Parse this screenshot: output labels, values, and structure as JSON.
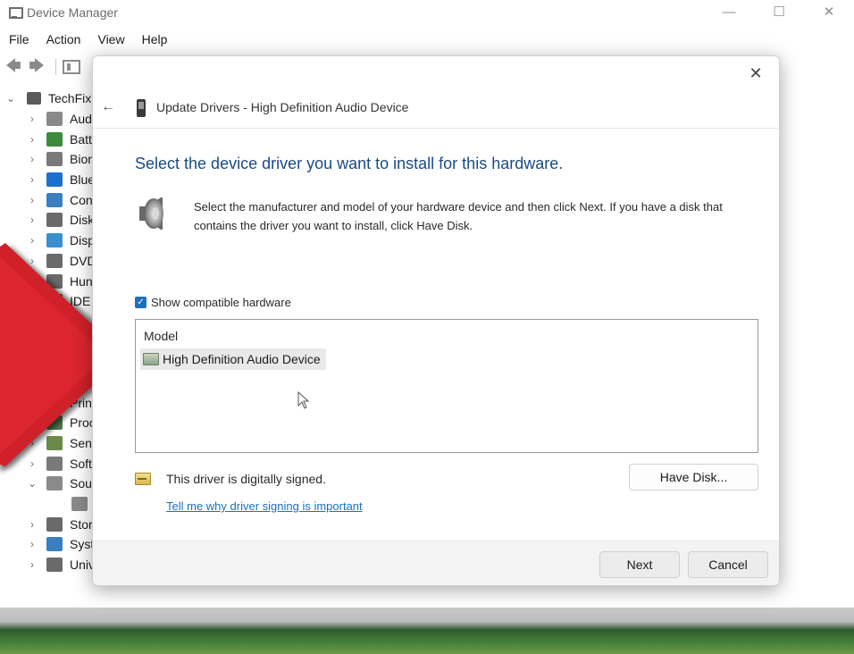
{
  "window": {
    "title": "Device Manager",
    "controls": {
      "minimize": "—",
      "maximize": "☐",
      "close": "✕"
    }
  },
  "menubar": {
    "items": [
      "File",
      "Action",
      "View",
      "Help"
    ]
  },
  "tree": {
    "root": "TechFix",
    "items": [
      {
        "label": "Aud",
        "icon": "speaker-icon",
        "color": "#8a8a8a",
        "expanded": false
      },
      {
        "label": "Batt",
        "icon": "battery-icon",
        "color": "#3d8a3d",
        "expanded": false
      },
      {
        "label": "Bion",
        "icon": "biometric-icon",
        "color": "#7a7a7a",
        "expanded": false
      },
      {
        "label": "Blue",
        "icon": "bluetooth-icon",
        "color": "#1e6fd0",
        "expanded": false
      },
      {
        "label": "Con",
        "icon": "computer-icon",
        "color": "#3a7fc0",
        "expanded": false
      },
      {
        "label": "Disk",
        "icon": "disk-icon",
        "color": "#6a6a6a",
        "expanded": false
      },
      {
        "label": "Disp",
        "icon": "display-icon",
        "color": "#3a8fcf",
        "expanded": false
      },
      {
        "label": "DVD",
        "icon": "dvd-icon",
        "color": "#6a6a6a",
        "expanded": false
      },
      {
        "label": "Hun",
        "icon": "hid-icon",
        "color": "#6a6a6a",
        "expanded": false
      },
      {
        "label": "IDE",
        "icon": "ide-icon",
        "color": "#6a6a6a",
        "expanded": false
      },
      {
        "label": "",
        "icon": "",
        "color": "",
        "expanded": false
      },
      {
        "label": "",
        "icon": "",
        "color": "",
        "expanded": false
      },
      {
        "label": "",
        "icon": "",
        "color": "",
        "expanded": false
      },
      {
        "label": "",
        "icon": "",
        "color": "",
        "expanded": false
      },
      {
        "label": "Print",
        "icon": "printer-icon",
        "color": "#6a6a6a",
        "expanded": false
      },
      {
        "label": "Proc",
        "icon": "processor-icon",
        "color": "#4a7a4a",
        "expanded": false
      },
      {
        "label": "Sen",
        "icon": "sensor-icon",
        "color": "#6a8a4a",
        "expanded": false
      },
      {
        "label": "Soft",
        "icon": "software-icon",
        "color": "#7a7a7a",
        "expanded": false
      },
      {
        "label": "Sou",
        "icon": "sound-icon",
        "color": "#8a8a8a",
        "expanded": true
      },
      {
        "label": "",
        "icon": "speaker-icon",
        "color": "#8a8a8a",
        "expanded": false,
        "child": true
      },
      {
        "label": "Stor",
        "icon": "storage-icon",
        "color": "#6a6a6a",
        "expanded": false
      },
      {
        "label": "Syst",
        "icon": "system-icon",
        "color": "#3a7fc0",
        "expanded": false
      },
      {
        "label": "Universal Serial Bus controllers",
        "icon": "usb-icon",
        "color": "#6a6a6a",
        "expanded": false
      }
    ]
  },
  "dialog": {
    "title": "Update Drivers - High Definition Audio Device",
    "heading": "Select the device driver you want to install for this hardware.",
    "instructions": "Select the manufacturer and model of your hardware device and then click Next. If you have a disk that contains the driver you want to install, click Have Disk.",
    "show_compatible_label": "Show compatible hardware",
    "show_compatible_checked": true,
    "model_header": "Model",
    "models": [
      "High Definition Audio Device"
    ],
    "signed_text": "This driver is digitally signed.",
    "signing_link": "Tell me why driver signing is important",
    "have_disk": "Have Disk...",
    "next": "Next",
    "cancel": "Cancel",
    "close": "✕",
    "back": "←"
  },
  "colors": {
    "heading": "#1a4a85",
    "link": "#1e6fbe",
    "checkbox": "#1e6fbe",
    "arrow": "#d0202a"
  }
}
